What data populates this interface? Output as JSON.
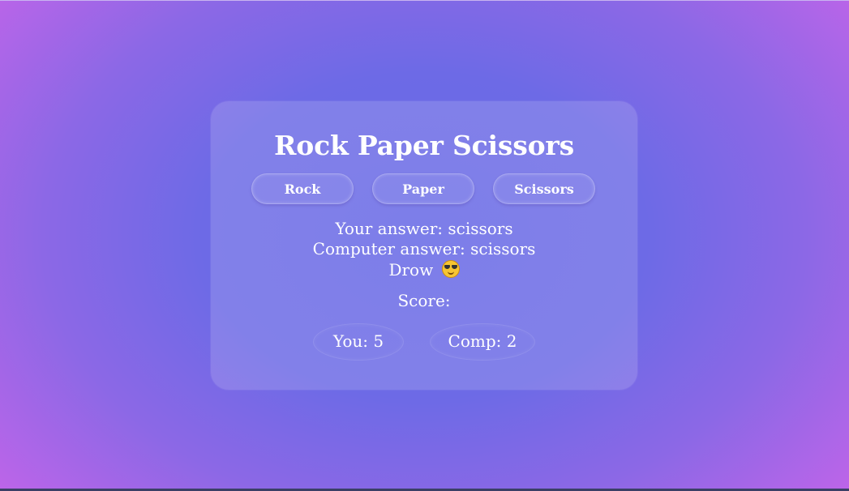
{
  "game": {
    "title": "Rock Paper Scissors",
    "buttons": [
      {
        "label": "Rock"
      },
      {
        "label": "Paper"
      },
      {
        "label": "Scissors"
      }
    ],
    "result": {
      "your_answer": "Your answer: scissors",
      "computer_answer": "Computer answer: scissors",
      "outcome": "Drow",
      "outcome_icon": "smiling-face-with-sunglasses-icon"
    },
    "score": {
      "label": "Score:",
      "you": "You: 5",
      "comp": "Comp: 2"
    }
  },
  "colors": {
    "background_center": "#6668e6",
    "background_edge": "#d663ec",
    "text": "#ffffff"
  }
}
